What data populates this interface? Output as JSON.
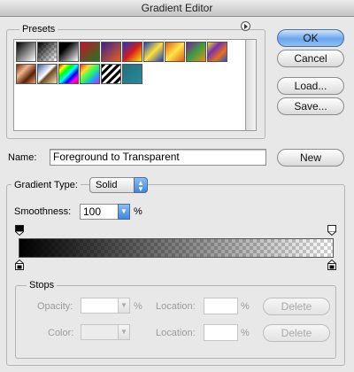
{
  "window": {
    "title": "Gradient Editor"
  },
  "presets": {
    "label": "Presets",
    "menu_icon": "circle-arrow-right-icon",
    "swatches": [
      {
        "name": "foreground-to-background",
        "bg": "linear-gradient(135deg,#000,#fff)"
      },
      {
        "name": "foreground-to-transparent",
        "bg": "linear-gradient(135deg,#000 0%,rgba(0,0,0,0) 100%), repeating-conic-gradient(#ccc 0 25%,#fff 0 50%) 0 0/6px 6px"
      },
      {
        "name": "black-white",
        "bg": "linear-gradient(135deg,#000 30%,#fff)"
      },
      {
        "name": "red-green",
        "bg": "linear-gradient(135deg,#c8102e,#1f7a1f)"
      },
      {
        "name": "violet-orange",
        "bg": "linear-gradient(135deg,#3b1f8f,#e8611c)"
      },
      {
        "name": "blue-red-yellow",
        "bg": "linear-gradient(135deg,#2233cc,#d21b1b,#ffe600)"
      },
      {
        "name": "blue-yellow-blue",
        "bg": "linear-gradient(135deg,#1a3fbf,#ffe23a,#1a3fbf)"
      },
      {
        "name": "orange-yellow-orange",
        "bg": "linear-gradient(135deg,#e25b12,#ffe54a,#e25b12)"
      },
      {
        "name": "violet-green-orange",
        "bg": "linear-gradient(135deg,#7a1fa2,#3e9e3e,#f08a1c)"
      },
      {
        "name": "yellow-violet-orange-blue",
        "bg": "linear-gradient(135deg,#f2e21a,#7a2fb0,#e8701c,#2a4fd0)"
      },
      {
        "name": "copper",
        "bg": "linear-gradient(135deg,#6b2c12,#f1b58b,#5a1f08,#e7a17a)"
      },
      {
        "name": "chrome",
        "bg": "linear-gradient(135deg,#3a5fa8,#fff 45%,#6b4a1f 55%,#f3e2c3)"
      },
      {
        "name": "spectrum",
        "bg": "linear-gradient(135deg,#f00,#ff0,#0f0,#0ff,#00f,#f0f,#f00)"
      },
      {
        "name": "transparent-rainbow",
        "bg": "linear-gradient(135deg,#ff2a2a,#ffd92a,#2aff5a,#2a9cff,#c42aff)"
      },
      {
        "name": "transparent-stripes",
        "bg": "repeating-linear-gradient(135deg,#000 0 3px,#fff 3px 6px)"
      },
      {
        "name": "teal",
        "bg": "linear-gradient(135deg,#1f6f7f,#2e8a9a)"
      }
    ]
  },
  "buttons": {
    "ok": "OK",
    "cancel": "Cancel",
    "load": "Load...",
    "save": "Save...",
    "new": "New"
  },
  "name_row": {
    "label": "Name:",
    "value": "Foreground to Transparent"
  },
  "gradient": {
    "type_label": "Gradient Type:",
    "type_value": "Solid",
    "smoothness_label": "Smoothness:",
    "smoothness_value": "100",
    "smoothness_unit": "%",
    "colors": {
      "start": "#000000",
      "end": "#000000"
    },
    "opacity": {
      "start": 100,
      "end": 0
    }
  },
  "stops": {
    "label": "Stops",
    "opacity_label": "Opacity:",
    "opacity_value": "",
    "opacity_unit": "%",
    "opacity_location_label": "Location:",
    "opacity_location_value": "",
    "opacity_location_unit": "%",
    "opacity_delete": "Delete",
    "color_label": "Color:",
    "color_location_label": "Location:",
    "color_location_value": "",
    "color_location_unit": "%",
    "color_delete": "Delete"
  }
}
